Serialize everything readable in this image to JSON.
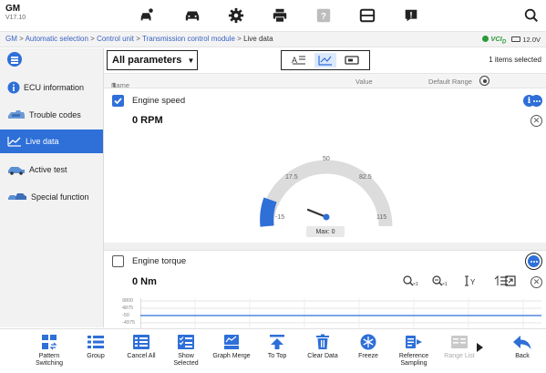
{
  "app": {
    "name": "GM",
    "version": "V17.10"
  },
  "breadcrumb": {
    "items": [
      "GM",
      "Automatic selection",
      "Control unit",
      "Transmission control module",
      "Live data"
    ],
    "separator": " > "
  },
  "status": {
    "vci_label": "VCI",
    "vci_sub": "D",
    "battery": "12.0V"
  },
  "top_icons": [
    "car-diagnose-icon",
    "car-icon",
    "gear-icon",
    "printer-icon",
    "help-icon",
    "save-icon",
    "feedback-icon",
    "search-icon"
  ],
  "sidebar": {
    "items": [
      {
        "label": "ECU information",
        "icon": "info-icon",
        "active": false
      },
      {
        "label": "Trouble codes",
        "icon": "engine-icon",
        "active": false
      },
      {
        "label": "Live data",
        "icon": "chart-line-icon",
        "active": true
      },
      {
        "label": "Active test",
        "icon": "car-icon",
        "active": false
      },
      {
        "label": "Special function",
        "icon": "car-group-icon",
        "active": false
      }
    ]
  },
  "toolbar": {
    "select_value": "All parameters",
    "selected_count": "1 items selected"
  },
  "columns": {
    "name": "Name",
    "value": "Value",
    "default_range": "Default Range"
  },
  "params": [
    {
      "name": "Engine speed",
      "value": "0 RPM",
      "checked": true,
      "gauge": {
        "min_label": "-15",
        "labels": [
          "17.5",
          "50",
          "82.5"
        ],
        "max_label": "115",
        "max_text": "Max: 0"
      }
    },
    {
      "name": "Engine torque",
      "value": "0 Nm",
      "checked": false,
      "y_ticks": [
        "9800",
        "4875",
        "-50",
        "-4975"
      ]
    }
  ],
  "bottom": [
    {
      "label": "Pattern\nSwitching",
      "icon": "pattern-switch-icon",
      "enabled": true
    },
    {
      "label": "Group",
      "icon": "group-icon",
      "enabled": true
    },
    {
      "label": "Cancel All",
      "icon": "cancel-all-icon",
      "enabled": true
    },
    {
      "label": "Show\nSelected",
      "icon": "show-selected-icon",
      "enabled": true
    },
    {
      "label": "Graph Merge",
      "icon": "graph-merge-icon",
      "enabled": true
    },
    {
      "label": "To Top",
      "icon": "to-top-icon",
      "enabled": true
    },
    {
      "label": "Clear Data",
      "icon": "trash-icon",
      "enabled": true
    },
    {
      "label": "Freeze",
      "icon": "snowflake-icon",
      "enabled": true
    },
    {
      "label": "Reference\nSampling",
      "icon": "reference-sampling-icon",
      "enabled": true
    },
    {
      "label": "Range List",
      "icon": "range-list-icon",
      "enabled": false
    },
    {
      "label": "",
      "icon": "play-icon",
      "enabled": true
    },
    {
      "label": "Back",
      "icon": "back-icon",
      "enabled": true
    }
  ],
  "colors": {
    "accent": "#2e6fd8",
    "gauge_fill": "#2e6fd8",
    "gauge_track": "#dcdcdc"
  }
}
